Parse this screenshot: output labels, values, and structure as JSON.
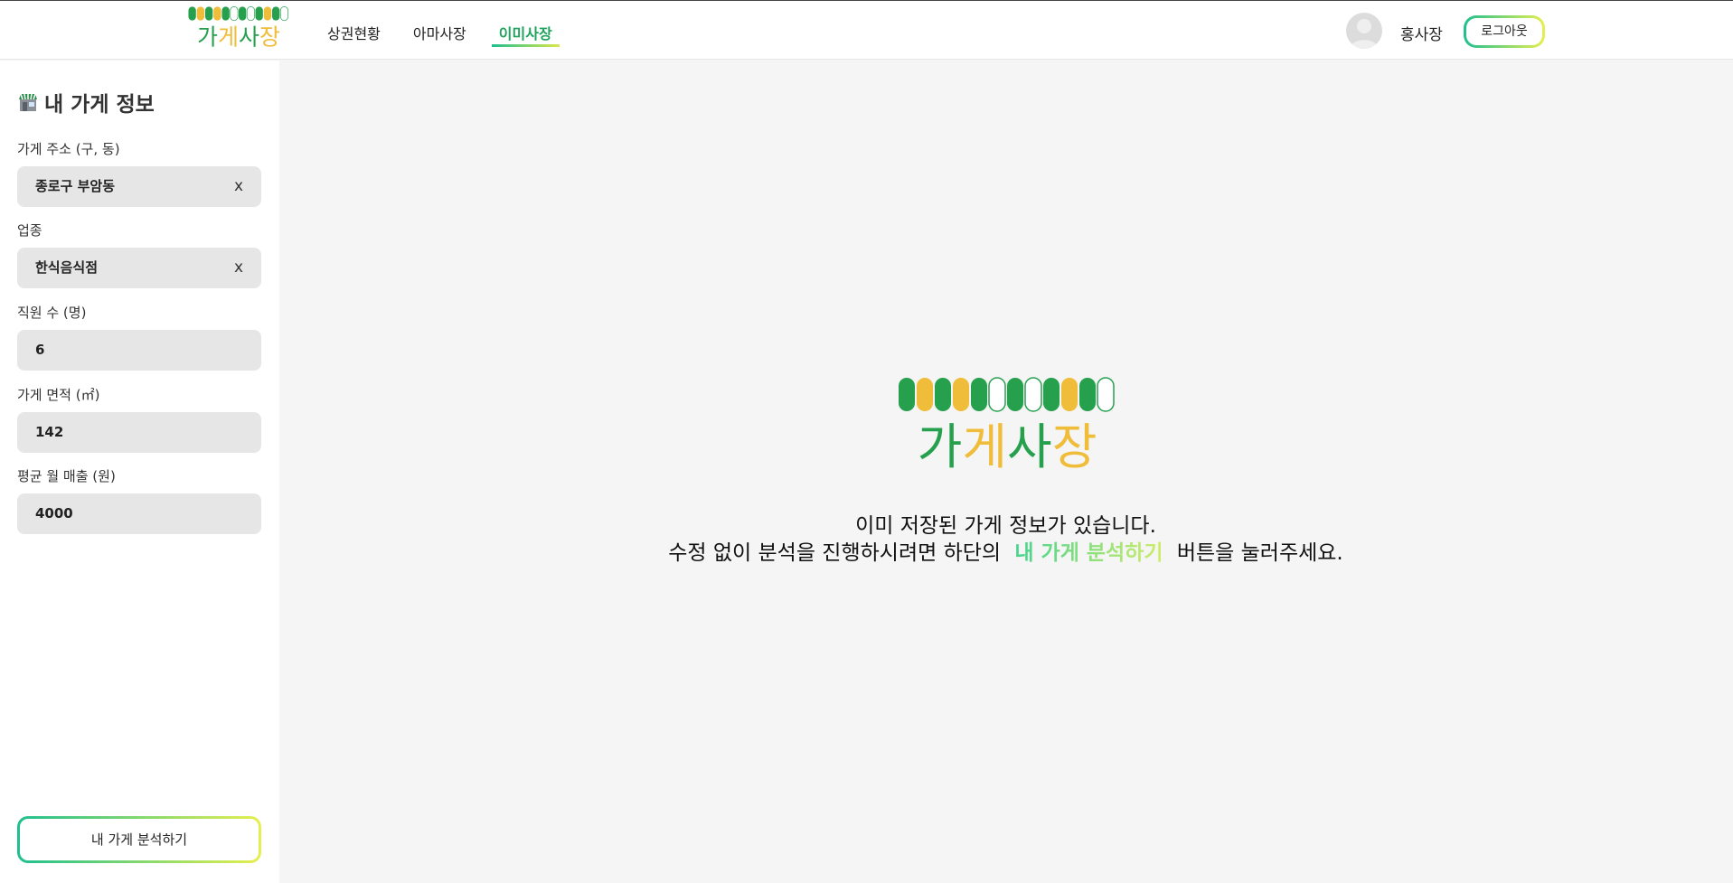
{
  "header": {
    "logo_text": "가게사장",
    "nav": [
      {
        "label": "상권현황",
        "active": false
      },
      {
        "label": "아마사장",
        "active": false
      },
      {
        "label": "이미사장",
        "active": true
      }
    ],
    "user_name": "홍사장",
    "logout_label": "로그아웃"
  },
  "sidebar": {
    "title": "내 가게 정보",
    "fields": {
      "address": {
        "label": "가게 주소 (구, 동)",
        "value": "종로구 부암동",
        "clear": "x"
      },
      "category": {
        "label": "업종",
        "value": "한식음식점",
        "clear": "x"
      },
      "employees": {
        "label": "직원 수 (명)",
        "value": "6"
      },
      "area": {
        "label": "가게 면적 (㎡)",
        "value": "142"
      },
      "sales": {
        "label": "평균 월 매출 (원)",
        "value": "4000"
      }
    },
    "analyze_button": "내 가게 분석하기"
  },
  "main": {
    "logo_text": "가게사장",
    "line1": "이미 저장된 가게 정보가 있습니다.",
    "line2_before": "수정 없이 분석을 진행하시려면 하단의",
    "line2_highlight": "내 가게 분석하기",
    "line2_after": "버튼을 눌러주세요."
  },
  "colors": {
    "brand_green": "#1fa35c",
    "brand_yellow": "#f0bd3a",
    "gradient_start": "#1fbf8f",
    "gradient_end": "#e6ef4f"
  }
}
